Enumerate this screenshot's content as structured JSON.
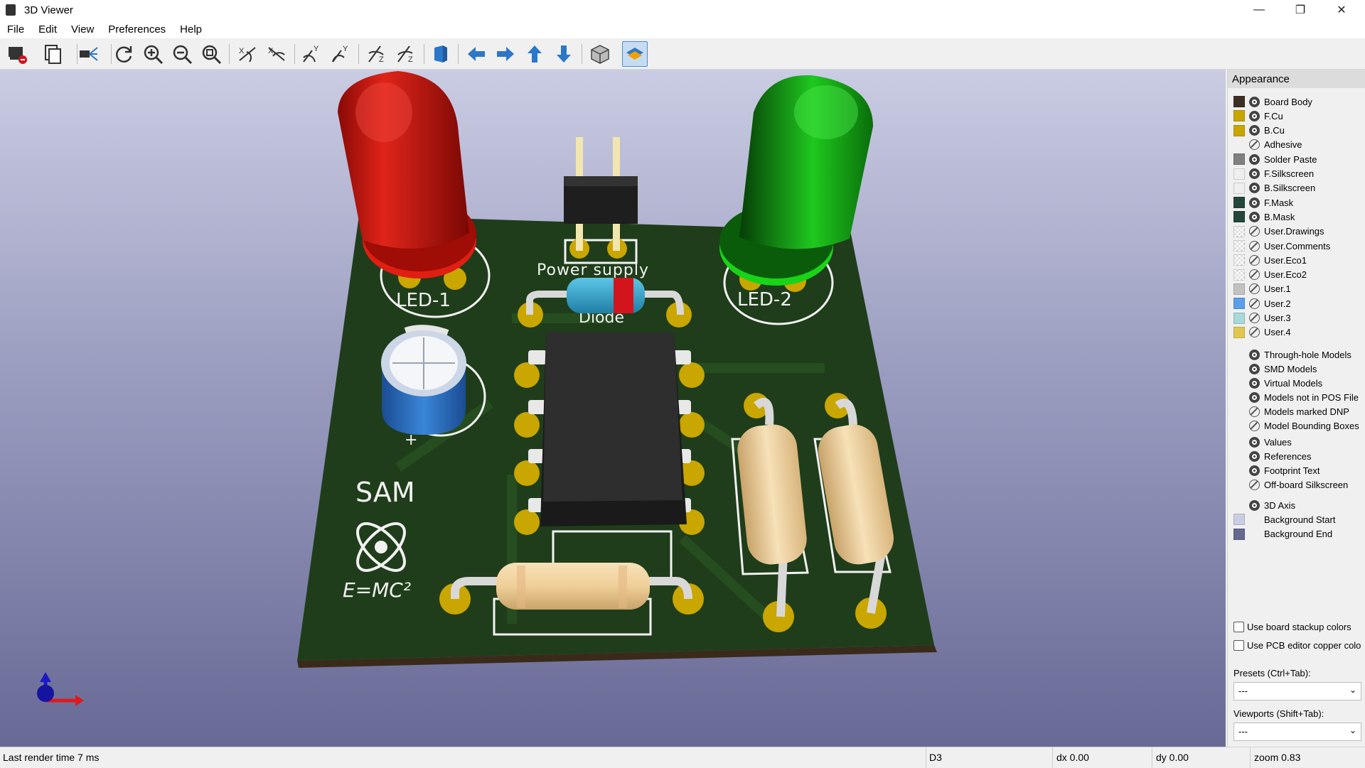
{
  "window": {
    "title": "3D Viewer",
    "minimize": "—",
    "restore": "❐",
    "close": "✕"
  },
  "menu": [
    "File",
    "Edit",
    "View",
    "Preferences",
    "Help"
  ],
  "toolbar": {
    "icons": [
      "render-raytracing-icon",
      "copy-3d-image-icon",
      "render-options-icon",
      "reload-board-icon",
      "zoom-in-icon",
      "zoom-out-icon",
      "zoom-fit-icon",
      "rotate-x-cw-icon",
      "rotate-x-ccw-icon",
      "rotate-y-cw-icon",
      "rotate-y-ccw-icon",
      "rotate-z-cw-icon",
      "rotate-z-ccw-icon",
      "flip-board-icon",
      "move-left-icon",
      "move-right-icon",
      "move-up-icon",
      "move-down-icon",
      "orthographic-icon",
      "layers-manager-icon"
    ]
  },
  "board": {
    "silkscreen": {
      "led1": "LED-1",
      "led2": "LED-2",
      "power": "Power supply",
      "diode": "Diode",
      "logo_name": "SAM",
      "logo_formula": "E=MC²",
      "cap_plus": "+"
    },
    "colors": {
      "board": "#1f3d1a",
      "copper": "#c9a600",
      "red_led": "#d4140c",
      "green_led": "#15d414",
      "capacitor": "#2463b5",
      "resistor": "#f1d4a2",
      "ic": "#252525"
    }
  },
  "appearance": {
    "title": "Appearance",
    "layers": [
      {
        "name": "Board Body",
        "color": "#3c3023",
        "visible": true
      },
      {
        "name": "F.Cu",
        "color": "#c8a600",
        "visible": true
      },
      {
        "name": "B.Cu",
        "color": "#c8a600",
        "visible": true
      },
      {
        "name": "Adhesive",
        "color": "",
        "visible": false
      },
      {
        "name": "Solder Paste",
        "color": "#808080",
        "visible": true
      },
      {
        "name": "F.Silkscreen",
        "color": "#efefef",
        "visible": true
      },
      {
        "name": "B.Silkscreen",
        "color": "#efefef",
        "visible": true
      },
      {
        "name": "F.Mask",
        "color": "#24473a",
        "visible": true
      },
      {
        "name": "B.Mask",
        "color": "#24473a",
        "visible": true
      },
      {
        "name": "User.Drawings",
        "color": "checker",
        "visible": false
      },
      {
        "name": "User.Comments",
        "color": "checker",
        "visible": false
      },
      {
        "name": "User.Eco1",
        "color": "checker",
        "visible": false
      },
      {
        "name": "User.Eco2",
        "color": "checker",
        "visible": false
      },
      {
        "name": "User.1",
        "color": "#c2c2c2",
        "visible": false
      },
      {
        "name": "User.2",
        "color": "#5aa0e8",
        "visible": false
      },
      {
        "name": "User.3",
        "color": "#a8d8d8",
        "visible": false
      },
      {
        "name": "User.4",
        "color": "#e0c850",
        "visible": false
      }
    ],
    "models": [
      {
        "name": "Through-hole Models",
        "visible": true
      },
      {
        "name": "SMD Models",
        "visible": true
      },
      {
        "name": "Virtual Models",
        "visible": true
      },
      {
        "name": "Models not in POS File",
        "visible": true
      },
      {
        "name": "Models marked DNP",
        "visible": false
      },
      {
        "name": "Model Bounding Boxes",
        "visible": false
      }
    ],
    "texts": [
      {
        "name": "Values",
        "visible": true
      },
      {
        "name": "References",
        "visible": true
      },
      {
        "name": "Footprint Text",
        "visible": true
      },
      {
        "name": "Off-board Silkscreen",
        "visible": false
      }
    ],
    "misc": [
      {
        "name": "3D Axis",
        "visible": true,
        "color": ""
      },
      {
        "name": "Background Start",
        "visible": null,
        "color": "#cccde4"
      },
      {
        "name": "Background End",
        "visible": null,
        "color": "#666891"
      }
    ],
    "checkbox_stackup": "Use board stackup colors",
    "checkbox_copper": "Use PCB editor copper colo",
    "presets_label": "Presets (Ctrl+Tab):",
    "presets_value": "---",
    "viewports_label": "Viewports (Shift+Tab):",
    "viewports_value": "---"
  },
  "status": {
    "render_time": "Last render time 7 ms",
    "ref": "D3",
    "dx": "dx 0.00",
    "dy": "dy 0.00",
    "zoom": "zoom 0.83"
  }
}
